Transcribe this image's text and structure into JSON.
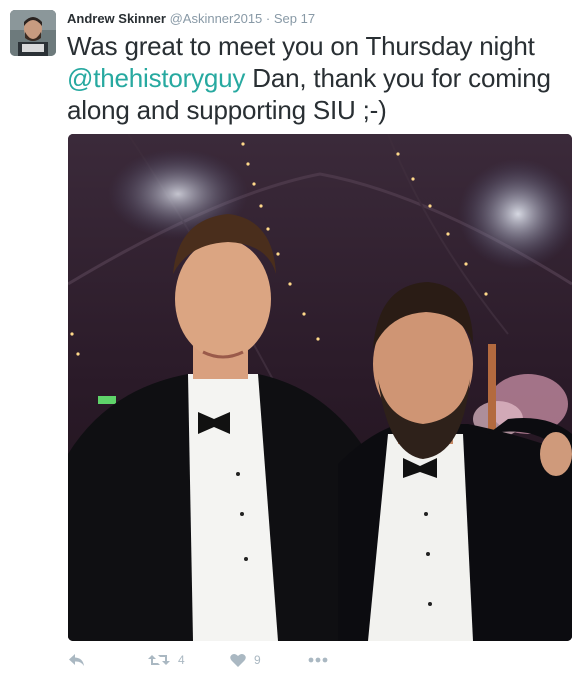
{
  "tweet": {
    "author_name": "Andrew Skinner",
    "handle": "@Askinner2015",
    "separator": "·",
    "time": "Sep 17",
    "text_before": "Was great to meet you on Thursday night ",
    "mention": "@thehistoryguy",
    "text_after": " Dan, thank you for coming along and supporting SIU ;-)"
  },
  "actions": {
    "retweet_count": "4",
    "like_count": "9"
  },
  "icons": {
    "reply": "reply-icon",
    "retweet": "retweet-icon",
    "like": "heart-icon",
    "more": "more-icon"
  },
  "colors": {
    "mention": "#27a9a0",
    "icon_gray": "#aab8c2",
    "meta_gray": "#8899a6",
    "text": "#292f33"
  }
}
